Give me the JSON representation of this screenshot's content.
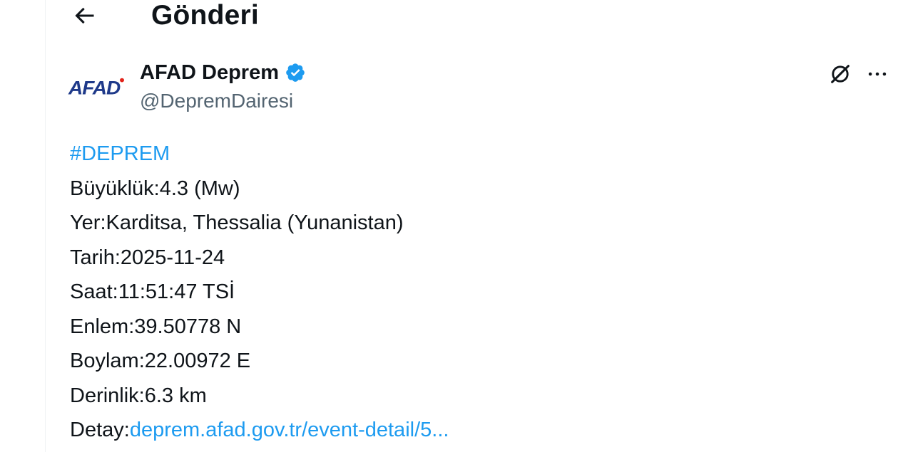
{
  "header": {
    "title": "Gönderi"
  },
  "author": {
    "name": "AFAD Deprem",
    "handle": "@DepremDairesi",
    "avatar_text": "AFAD",
    "verified": true
  },
  "colors": {
    "link": "#1d9bf0",
    "text": "#0f1419",
    "muted": "#536471",
    "verified": "#1d9bf0",
    "afad_blue": "#1f3a8a",
    "afad_red": "#e2231a"
  },
  "icons": {
    "back": "arrow-left-icon",
    "verified": "verified-badge-icon",
    "grok": "grok-icon",
    "more": "more-horizontal-icon"
  },
  "tweet": {
    "hashtag": "#DEPREM",
    "lines": [
      "Büyüklük:4.3 (Mw)",
      "Yer:Karditsa, Thessalia (Yunanistan)",
      "Tarih:2025-11-24",
      "Saat:11:51:47 TSİ",
      "Enlem:39.50778 N",
      "Boylam:22.00972 E",
      "Derinlik:6.3 km"
    ],
    "detail_label": "Detay:",
    "detail_link": "deprem.afad.gov.tr/event-detail/5..."
  }
}
